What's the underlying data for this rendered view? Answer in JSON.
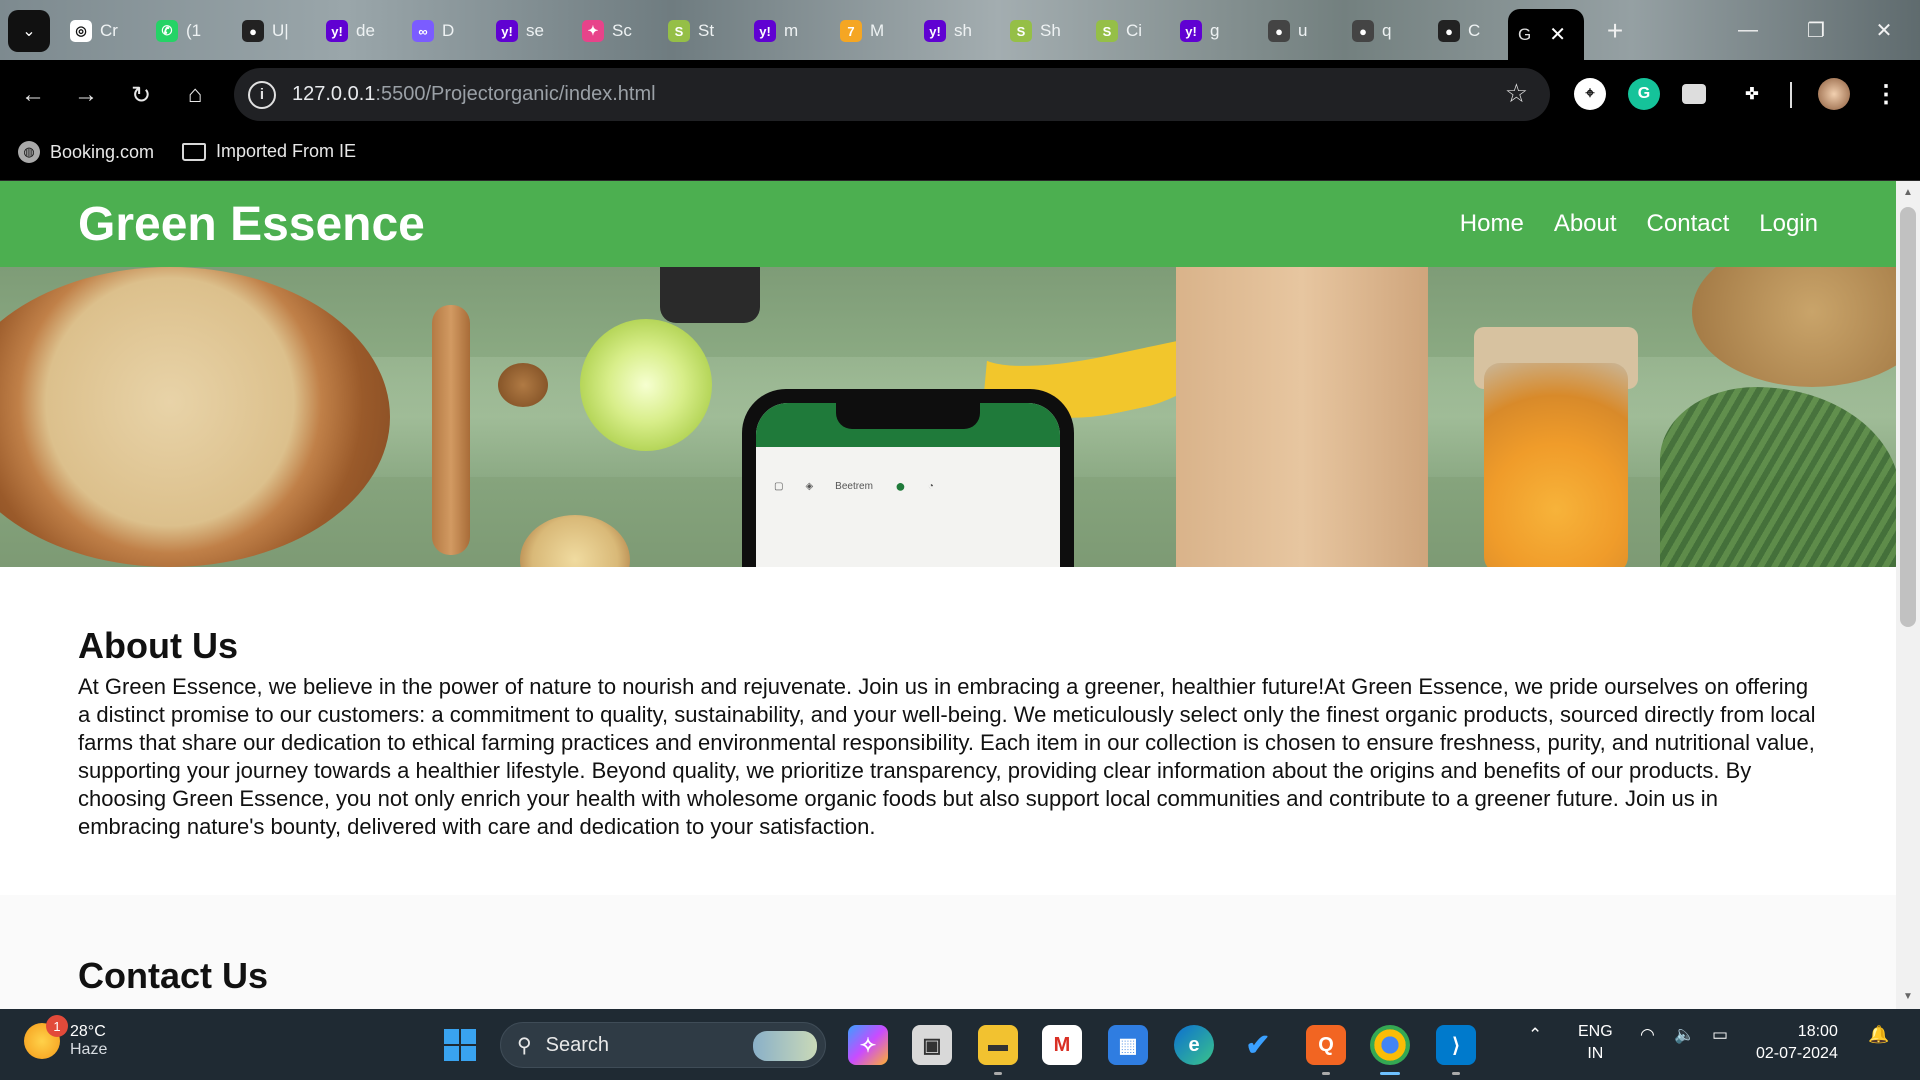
{
  "browser": {
    "tabs": [
      {
        "icon": "chatgpt-icon",
        "label": "Cr",
        "bg": "#ffffff",
        "fg": "#111",
        "glyph": "◎"
      },
      {
        "icon": "whatsapp-icon",
        "label": "(1",
        "bg": "#25d366",
        "fg": "#fff",
        "glyph": "✆"
      },
      {
        "icon": "github-icon",
        "label": "U|",
        "bg": "#222",
        "fg": "#fff",
        "glyph": "●"
      },
      {
        "icon": "yahoo-icon",
        "label": "de",
        "bg": "#6001d2",
        "fg": "#fff",
        "glyph": "y!"
      },
      {
        "icon": "canva-icon",
        "label": "D",
        "bg": "#7b5cff",
        "fg": "#fff",
        "glyph": "∞"
      },
      {
        "icon": "yahoo-icon",
        "label": "se",
        "bg": "#6001d2",
        "fg": "#fff",
        "glyph": "y!"
      },
      {
        "icon": "skillshare-icon",
        "label": "Sc",
        "bg": "#e8438a",
        "fg": "#fff",
        "glyph": "✦"
      },
      {
        "icon": "shopify-icon",
        "label": "St",
        "bg": "#95bf47",
        "fg": "#fff",
        "glyph": "S"
      },
      {
        "icon": "yahoo-icon",
        "label": "m",
        "bg": "#6001d2",
        "fg": "#fff",
        "glyph": "y!"
      },
      {
        "icon": "mentor-icon",
        "label": "M",
        "bg": "#f5a623",
        "fg": "#fff",
        "glyph": "7"
      },
      {
        "icon": "yahoo-icon",
        "label": "sh",
        "bg": "#6001d2",
        "fg": "#fff",
        "glyph": "y!"
      },
      {
        "icon": "shopify-icon",
        "label": "Sh",
        "bg": "#95bf47",
        "fg": "#fff",
        "glyph": "S"
      },
      {
        "icon": "shopify-icon",
        "label": "Ci",
        "bg": "#95bf47",
        "fg": "#fff",
        "glyph": "S"
      },
      {
        "icon": "yahoo-icon",
        "label": "g",
        "bg": "#6001d2",
        "fg": "#fff",
        "glyph": "y!"
      },
      {
        "icon": "github-icon",
        "label": "u",
        "bg": "#444",
        "fg": "#fff",
        "glyph": "●"
      },
      {
        "icon": "github-icon",
        "label": "q",
        "bg": "#444",
        "fg": "#fff",
        "glyph": "●"
      },
      {
        "icon": "github-icon",
        "label": "C",
        "bg": "#222",
        "fg": "#fff",
        "glyph": "●"
      }
    ],
    "active_tab_label": "G",
    "url_host": "127.0.0.1",
    "url_rest": ":5500/Projectorganic/index.html",
    "bookmarks": [
      {
        "label": "Booking.com",
        "icon": "globe-icon"
      },
      {
        "label": "Imported From IE",
        "icon": "folder-icon"
      }
    ]
  },
  "site": {
    "brand": "Green Essence",
    "nav": [
      "Home",
      "About",
      "Contact",
      "Login"
    ],
    "hero_phone_text": "Beetrem",
    "about_title": "About Us",
    "about_text": "At Green Essence, we believe in the power of nature to nourish and rejuvenate. Join us in embracing a greener, healthier future!At Green Essence, we pride ourselves on offering a distinct promise to our customers: a commitment to quality, sustainability, and your well-being. We meticulously select only the finest organic products, sourced directly from local farms that share our dedication to ethical farming practices and environmental responsibility. Each item in our collection is chosen to ensure freshness, purity, and nutritional value, supporting your journey towards a healthier lifestyle. Beyond quality, we prioritize transparency, providing clear information about the origins and benefits of our products. By choosing Green Essence, you not only enrich your health with wholesome organic foods but also support local communities and contribute to a greener future. Join us in embracing nature's bounty, delivered with care and dedication to your satisfaction.",
    "contact_title": "Contact Us",
    "accent_color": "#4caf50"
  },
  "taskbar": {
    "weather_temp": "28°C",
    "weather_desc": "Haze",
    "weather_badge": "1",
    "search_placeholder": "Search",
    "lang_line1": "ENG",
    "lang_line2": "IN",
    "time": "18:00",
    "date": "02-07-2024"
  }
}
